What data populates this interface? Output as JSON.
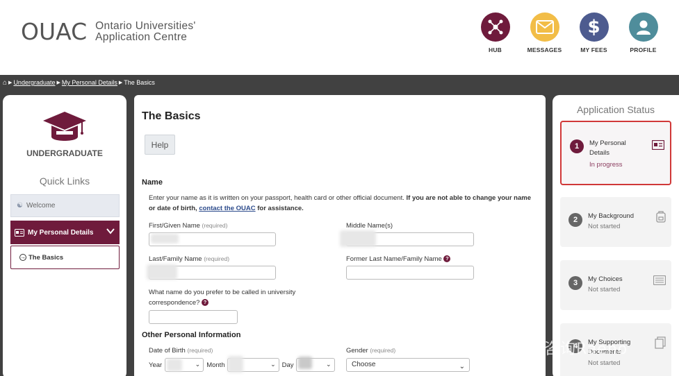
{
  "brand": {
    "mark": "OUAC",
    "name_line1": "Ontario Universities'",
    "name_line2": "Application Centre"
  },
  "nav": [
    {
      "label": "HUB",
      "icon": "hub-icon",
      "color": "#6f1b3c"
    },
    {
      "label": "MESSAGES",
      "icon": "envelope-icon",
      "color": "#f2bd47"
    },
    {
      "label": "MY FEES",
      "icon": "dollar-icon",
      "color": "#4d5b8f"
    },
    {
      "label": "PROFILE",
      "icon": "user-icon",
      "color": "#4f8d9b"
    }
  ],
  "breadcrumb": {
    "items": [
      "Undergraduate",
      "My Personal Details",
      "The Basics"
    ]
  },
  "left": {
    "title": "UNDERGRADUATE",
    "quick_links_title": "Quick Links",
    "welcome": "Welcome",
    "personal_details": "My Personal Details",
    "basics": "The Basics"
  },
  "main": {
    "title": "The Basics",
    "help": "Help",
    "name_section": "Name",
    "instr_plain": "Enter your name as it is written on your passport, health card or other official document. ",
    "instr_bold": "If you are not able to change your name or date of birth, ",
    "instr_link": "contact the OUAC",
    "instr_tail": " for assistance.",
    "first_name_label": "First/Given Name",
    "middle_name_label": "Middle Name(s)",
    "last_name_label": "Last/Family Name",
    "former_last_label": "Former Last Name/Family Name",
    "preferred_label": "What name do you prefer to be called in university correspondence?",
    "required": "(required)",
    "other_section": "Other Personal Information",
    "dob_label": "Date of Birth",
    "gender_label": "Gender",
    "year": "Year",
    "month": "Month",
    "day": "Day",
    "gender_value": "Choose"
  },
  "status": {
    "title": "Application Status",
    "steps": [
      {
        "num": "1",
        "name": "My Personal Details",
        "status": "In progress",
        "icon": "id-card-icon"
      },
      {
        "num": "2",
        "name": "My Background",
        "status": "Not started",
        "icon": "backpack-icon"
      },
      {
        "num": "3",
        "name": "My Choices",
        "status": "Not started",
        "icon": "list-icon"
      },
      {
        "num": "4",
        "name": "My Supporting Documents",
        "status": "Not started",
        "icon": "documents-icon"
      }
    ]
  },
  "watermark": "知乎 @日语咨询Raeno"
}
